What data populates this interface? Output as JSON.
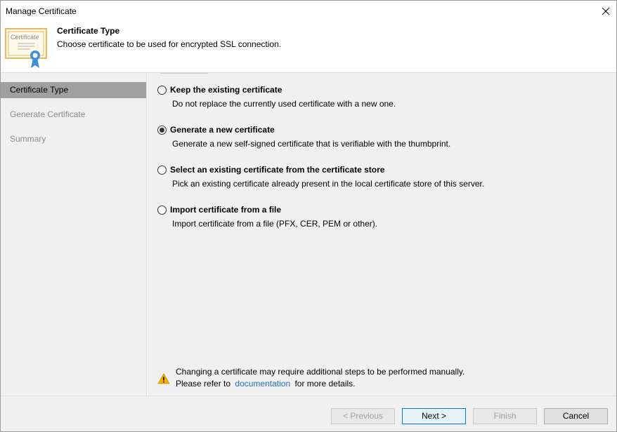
{
  "window": {
    "title": "Manage Certificate"
  },
  "header": {
    "title": "Certificate Type",
    "subtitle": "Choose certificate to be used for encrypted SSL connection.",
    "icon_label": "Certificate"
  },
  "sidebar": {
    "items": [
      {
        "label": "Certificate Type",
        "state": "active"
      },
      {
        "label": "Generate Certificate",
        "state": "disabled"
      },
      {
        "label": "Summary",
        "state": "disabled"
      }
    ]
  },
  "options": [
    {
      "label": "Keep the existing certificate",
      "description": "Do not replace the currently used certificate with a new one.",
      "checked": false
    },
    {
      "label": "Generate a new certificate",
      "description": "Generate a new self-signed certificate that is verifiable with the thumbprint.",
      "checked": true
    },
    {
      "label": "Select an existing certificate from the certificate store",
      "description": "Pick an existing certificate already present in the local certificate store of this server.",
      "checked": false
    },
    {
      "label": "Import certificate from a file",
      "description": "Import certificate from a file (PFX, CER, PEM or other).",
      "checked": false
    }
  ],
  "warning": {
    "line1": "Changing a certificate may require additional steps to be performed manually.",
    "line2_prefix": "Please refer to",
    "link_text": "documentation",
    "line2_suffix": "for more details."
  },
  "footer": {
    "previous_label": "< Previous",
    "next_label": "Next >",
    "finish_label": "Finish",
    "cancel_label": "Cancel"
  },
  "colors": {
    "accent": "#0078d7",
    "link": "#1a6fc4",
    "sidebar_active": "#a0a0a0",
    "certificate_ribbon": "#3a8fd8",
    "certificate_border": "#e8b860",
    "warning": "#f0b400"
  }
}
